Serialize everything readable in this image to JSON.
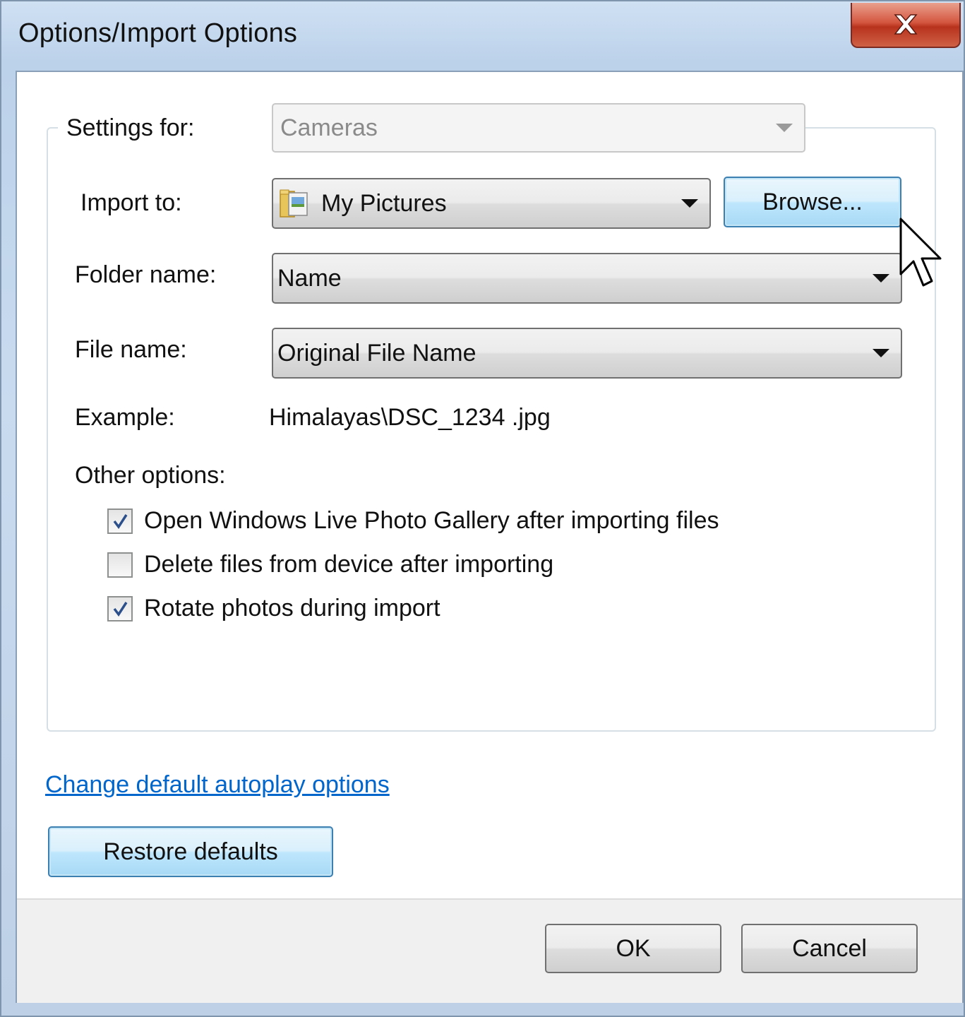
{
  "window": {
    "title": "Options/Import Options",
    "close_icon": "close-x-icon"
  },
  "settings": {
    "settings_for_label": "Settings for:",
    "settings_for_value": "Cameras",
    "import_to_label": "Import to:",
    "import_to_value": "My Pictures",
    "import_to_icon": "folder-pictures-icon",
    "browse_label": "Browse...",
    "folder_name_label": "Folder name:",
    "folder_name_value": "Name",
    "file_name_label": "File name:",
    "file_name_value": "Original File Name",
    "example_label": "Example:",
    "example_value": "Himalayas\\DSC_1234 .jpg"
  },
  "other_options": {
    "heading": "Other options:",
    "items": [
      {
        "label": "Open Windows Live Photo Gallery after importing files",
        "checked": true
      },
      {
        "label": "Delete files from device after importing",
        "checked": false
      },
      {
        "label": "Rotate photos during import",
        "checked": true
      }
    ]
  },
  "links": {
    "autoplay": "Change default autoplay options"
  },
  "buttons": {
    "restore_defaults": "Restore defaults",
    "ok": "OK",
    "cancel": "Cancel"
  },
  "colors": {
    "link": "#0066cc",
    "focus_border": "#3c7fb1",
    "close_red": "#c7432b"
  }
}
